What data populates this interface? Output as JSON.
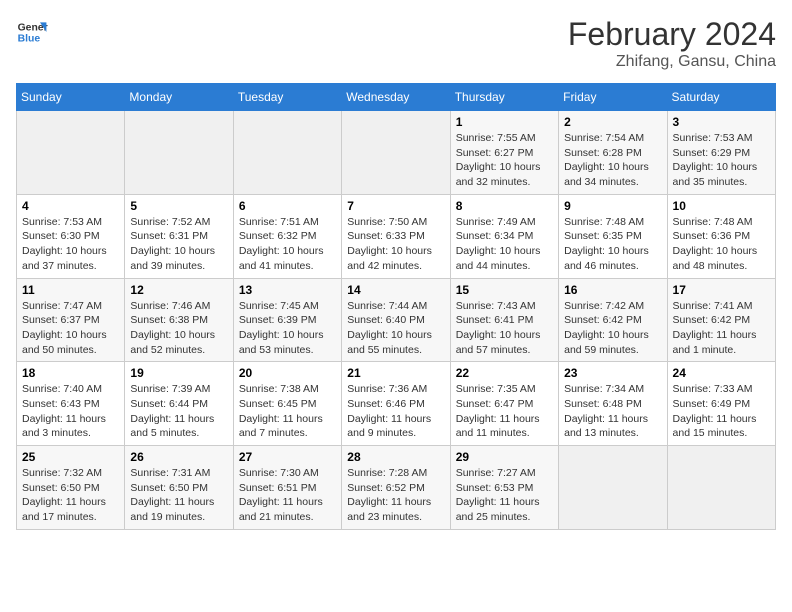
{
  "header": {
    "logo_line1": "General",
    "logo_line2": "Blue",
    "title": "February 2024",
    "subtitle": "Zhifang, Gansu, China"
  },
  "days_of_week": [
    "Sunday",
    "Monday",
    "Tuesday",
    "Wednesday",
    "Thursday",
    "Friday",
    "Saturday"
  ],
  "weeks": [
    [
      {
        "num": "",
        "info": ""
      },
      {
        "num": "",
        "info": ""
      },
      {
        "num": "",
        "info": ""
      },
      {
        "num": "",
        "info": ""
      },
      {
        "num": "1",
        "info": "Sunrise: 7:55 AM\nSunset: 6:27 PM\nDaylight: 10 hours\nand 32 minutes."
      },
      {
        "num": "2",
        "info": "Sunrise: 7:54 AM\nSunset: 6:28 PM\nDaylight: 10 hours\nand 34 minutes."
      },
      {
        "num": "3",
        "info": "Sunrise: 7:53 AM\nSunset: 6:29 PM\nDaylight: 10 hours\nand 35 minutes."
      }
    ],
    [
      {
        "num": "4",
        "info": "Sunrise: 7:53 AM\nSunset: 6:30 PM\nDaylight: 10 hours\nand 37 minutes."
      },
      {
        "num": "5",
        "info": "Sunrise: 7:52 AM\nSunset: 6:31 PM\nDaylight: 10 hours\nand 39 minutes."
      },
      {
        "num": "6",
        "info": "Sunrise: 7:51 AM\nSunset: 6:32 PM\nDaylight: 10 hours\nand 41 minutes."
      },
      {
        "num": "7",
        "info": "Sunrise: 7:50 AM\nSunset: 6:33 PM\nDaylight: 10 hours\nand 42 minutes."
      },
      {
        "num": "8",
        "info": "Sunrise: 7:49 AM\nSunset: 6:34 PM\nDaylight: 10 hours\nand 44 minutes."
      },
      {
        "num": "9",
        "info": "Sunrise: 7:48 AM\nSunset: 6:35 PM\nDaylight: 10 hours\nand 46 minutes."
      },
      {
        "num": "10",
        "info": "Sunrise: 7:48 AM\nSunset: 6:36 PM\nDaylight: 10 hours\nand 48 minutes."
      }
    ],
    [
      {
        "num": "11",
        "info": "Sunrise: 7:47 AM\nSunset: 6:37 PM\nDaylight: 10 hours\nand 50 minutes."
      },
      {
        "num": "12",
        "info": "Sunrise: 7:46 AM\nSunset: 6:38 PM\nDaylight: 10 hours\nand 52 minutes."
      },
      {
        "num": "13",
        "info": "Sunrise: 7:45 AM\nSunset: 6:39 PM\nDaylight: 10 hours\nand 53 minutes."
      },
      {
        "num": "14",
        "info": "Sunrise: 7:44 AM\nSunset: 6:40 PM\nDaylight: 10 hours\nand 55 minutes."
      },
      {
        "num": "15",
        "info": "Sunrise: 7:43 AM\nSunset: 6:41 PM\nDaylight: 10 hours\nand 57 minutes."
      },
      {
        "num": "16",
        "info": "Sunrise: 7:42 AM\nSunset: 6:42 PM\nDaylight: 10 hours\nand 59 minutes."
      },
      {
        "num": "17",
        "info": "Sunrise: 7:41 AM\nSunset: 6:42 PM\nDaylight: 11 hours\nand 1 minute."
      }
    ],
    [
      {
        "num": "18",
        "info": "Sunrise: 7:40 AM\nSunset: 6:43 PM\nDaylight: 11 hours\nand 3 minutes."
      },
      {
        "num": "19",
        "info": "Sunrise: 7:39 AM\nSunset: 6:44 PM\nDaylight: 11 hours\nand 5 minutes."
      },
      {
        "num": "20",
        "info": "Sunrise: 7:38 AM\nSunset: 6:45 PM\nDaylight: 11 hours\nand 7 minutes."
      },
      {
        "num": "21",
        "info": "Sunrise: 7:36 AM\nSunset: 6:46 PM\nDaylight: 11 hours\nand 9 minutes."
      },
      {
        "num": "22",
        "info": "Sunrise: 7:35 AM\nSunset: 6:47 PM\nDaylight: 11 hours\nand 11 minutes."
      },
      {
        "num": "23",
        "info": "Sunrise: 7:34 AM\nSunset: 6:48 PM\nDaylight: 11 hours\nand 13 minutes."
      },
      {
        "num": "24",
        "info": "Sunrise: 7:33 AM\nSunset: 6:49 PM\nDaylight: 11 hours\nand 15 minutes."
      }
    ],
    [
      {
        "num": "25",
        "info": "Sunrise: 7:32 AM\nSunset: 6:50 PM\nDaylight: 11 hours\nand 17 minutes."
      },
      {
        "num": "26",
        "info": "Sunrise: 7:31 AM\nSunset: 6:50 PM\nDaylight: 11 hours\nand 19 minutes."
      },
      {
        "num": "27",
        "info": "Sunrise: 7:30 AM\nSunset: 6:51 PM\nDaylight: 11 hours\nand 21 minutes."
      },
      {
        "num": "28",
        "info": "Sunrise: 7:28 AM\nSunset: 6:52 PM\nDaylight: 11 hours\nand 23 minutes."
      },
      {
        "num": "29",
        "info": "Sunrise: 7:27 AM\nSunset: 6:53 PM\nDaylight: 11 hours\nand 25 minutes."
      },
      {
        "num": "",
        "info": ""
      },
      {
        "num": "",
        "info": ""
      }
    ]
  ]
}
